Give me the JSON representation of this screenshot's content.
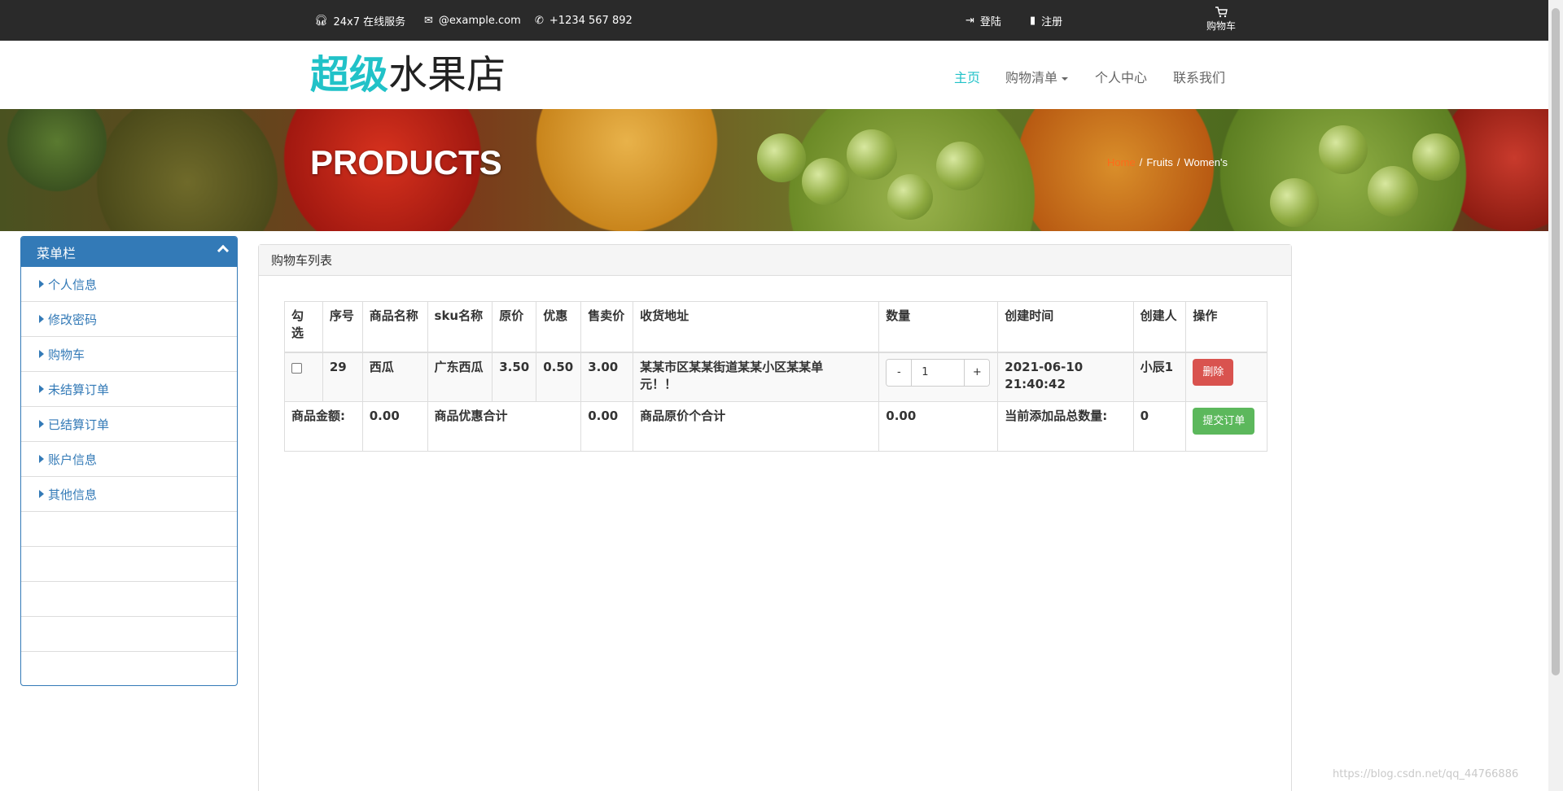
{
  "topbar": {
    "service": "24x7 在线服务",
    "email": "@example.com",
    "phone": "+1234 567 892",
    "login": "登陆",
    "register": "注册",
    "cart": "购物车"
  },
  "header": {
    "logo_accent": "超级",
    "logo_rest": "水果店",
    "nav": [
      "主页",
      "购物清单",
      "个人中心",
      "联系我们"
    ]
  },
  "banner": {
    "title": "PRODUCTS",
    "breadcrumb": [
      "Home",
      "Fruits",
      "Women's"
    ]
  },
  "sidebar": {
    "title": "菜单栏",
    "items": [
      "个人信息",
      "修改密码",
      "购物车",
      "未结算订单",
      "已结算订单",
      "账户信息",
      "其他信息"
    ]
  },
  "panel": {
    "title": "购物车列表",
    "columns": [
      "勾选",
      "序号",
      "商品名称",
      "sku名称",
      "原价",
      "优惠",
      "售卖价",
      "收货地址",
      "数量",
      "创建时间",
      "创建人",
      "操作"
    ],
    "row": {
      "id": "29",
      "name": "西瓜",
      "sku": "广东西瓜",
      "price": "3.50",
      "discount": "0.50",
      "sale": "3.00",
      "address": "某某市区某某街道某某小区某某单元！！",
      "qty": "1",
      "created": "2021-06-10 21:40:42",
      "creator": "小辰1",
      "delete": "删除"
    },
    "summary": {
      "amount_label": "商品金额:",
      "amount": "0.00",
      "discount_label": "商品优惠合计",
      "discount": "0.00",
      "orig_label": "商品原价个合计",
      "orig": "0.00",
      "count_label": "当前添加品总数量:",
      "count": "0",
      "submit": "提交订单"
    }
  },
  "watermark": "https://blog.csdn.net/qq_44766886",
  "colors": {
    "accent": "#21c2c8",
    "primary": "#337ab7",
    "danger": "#d9534f",
    "success": "#5cb85c",
    "topbar": "#2a2a2a"
  }
}
